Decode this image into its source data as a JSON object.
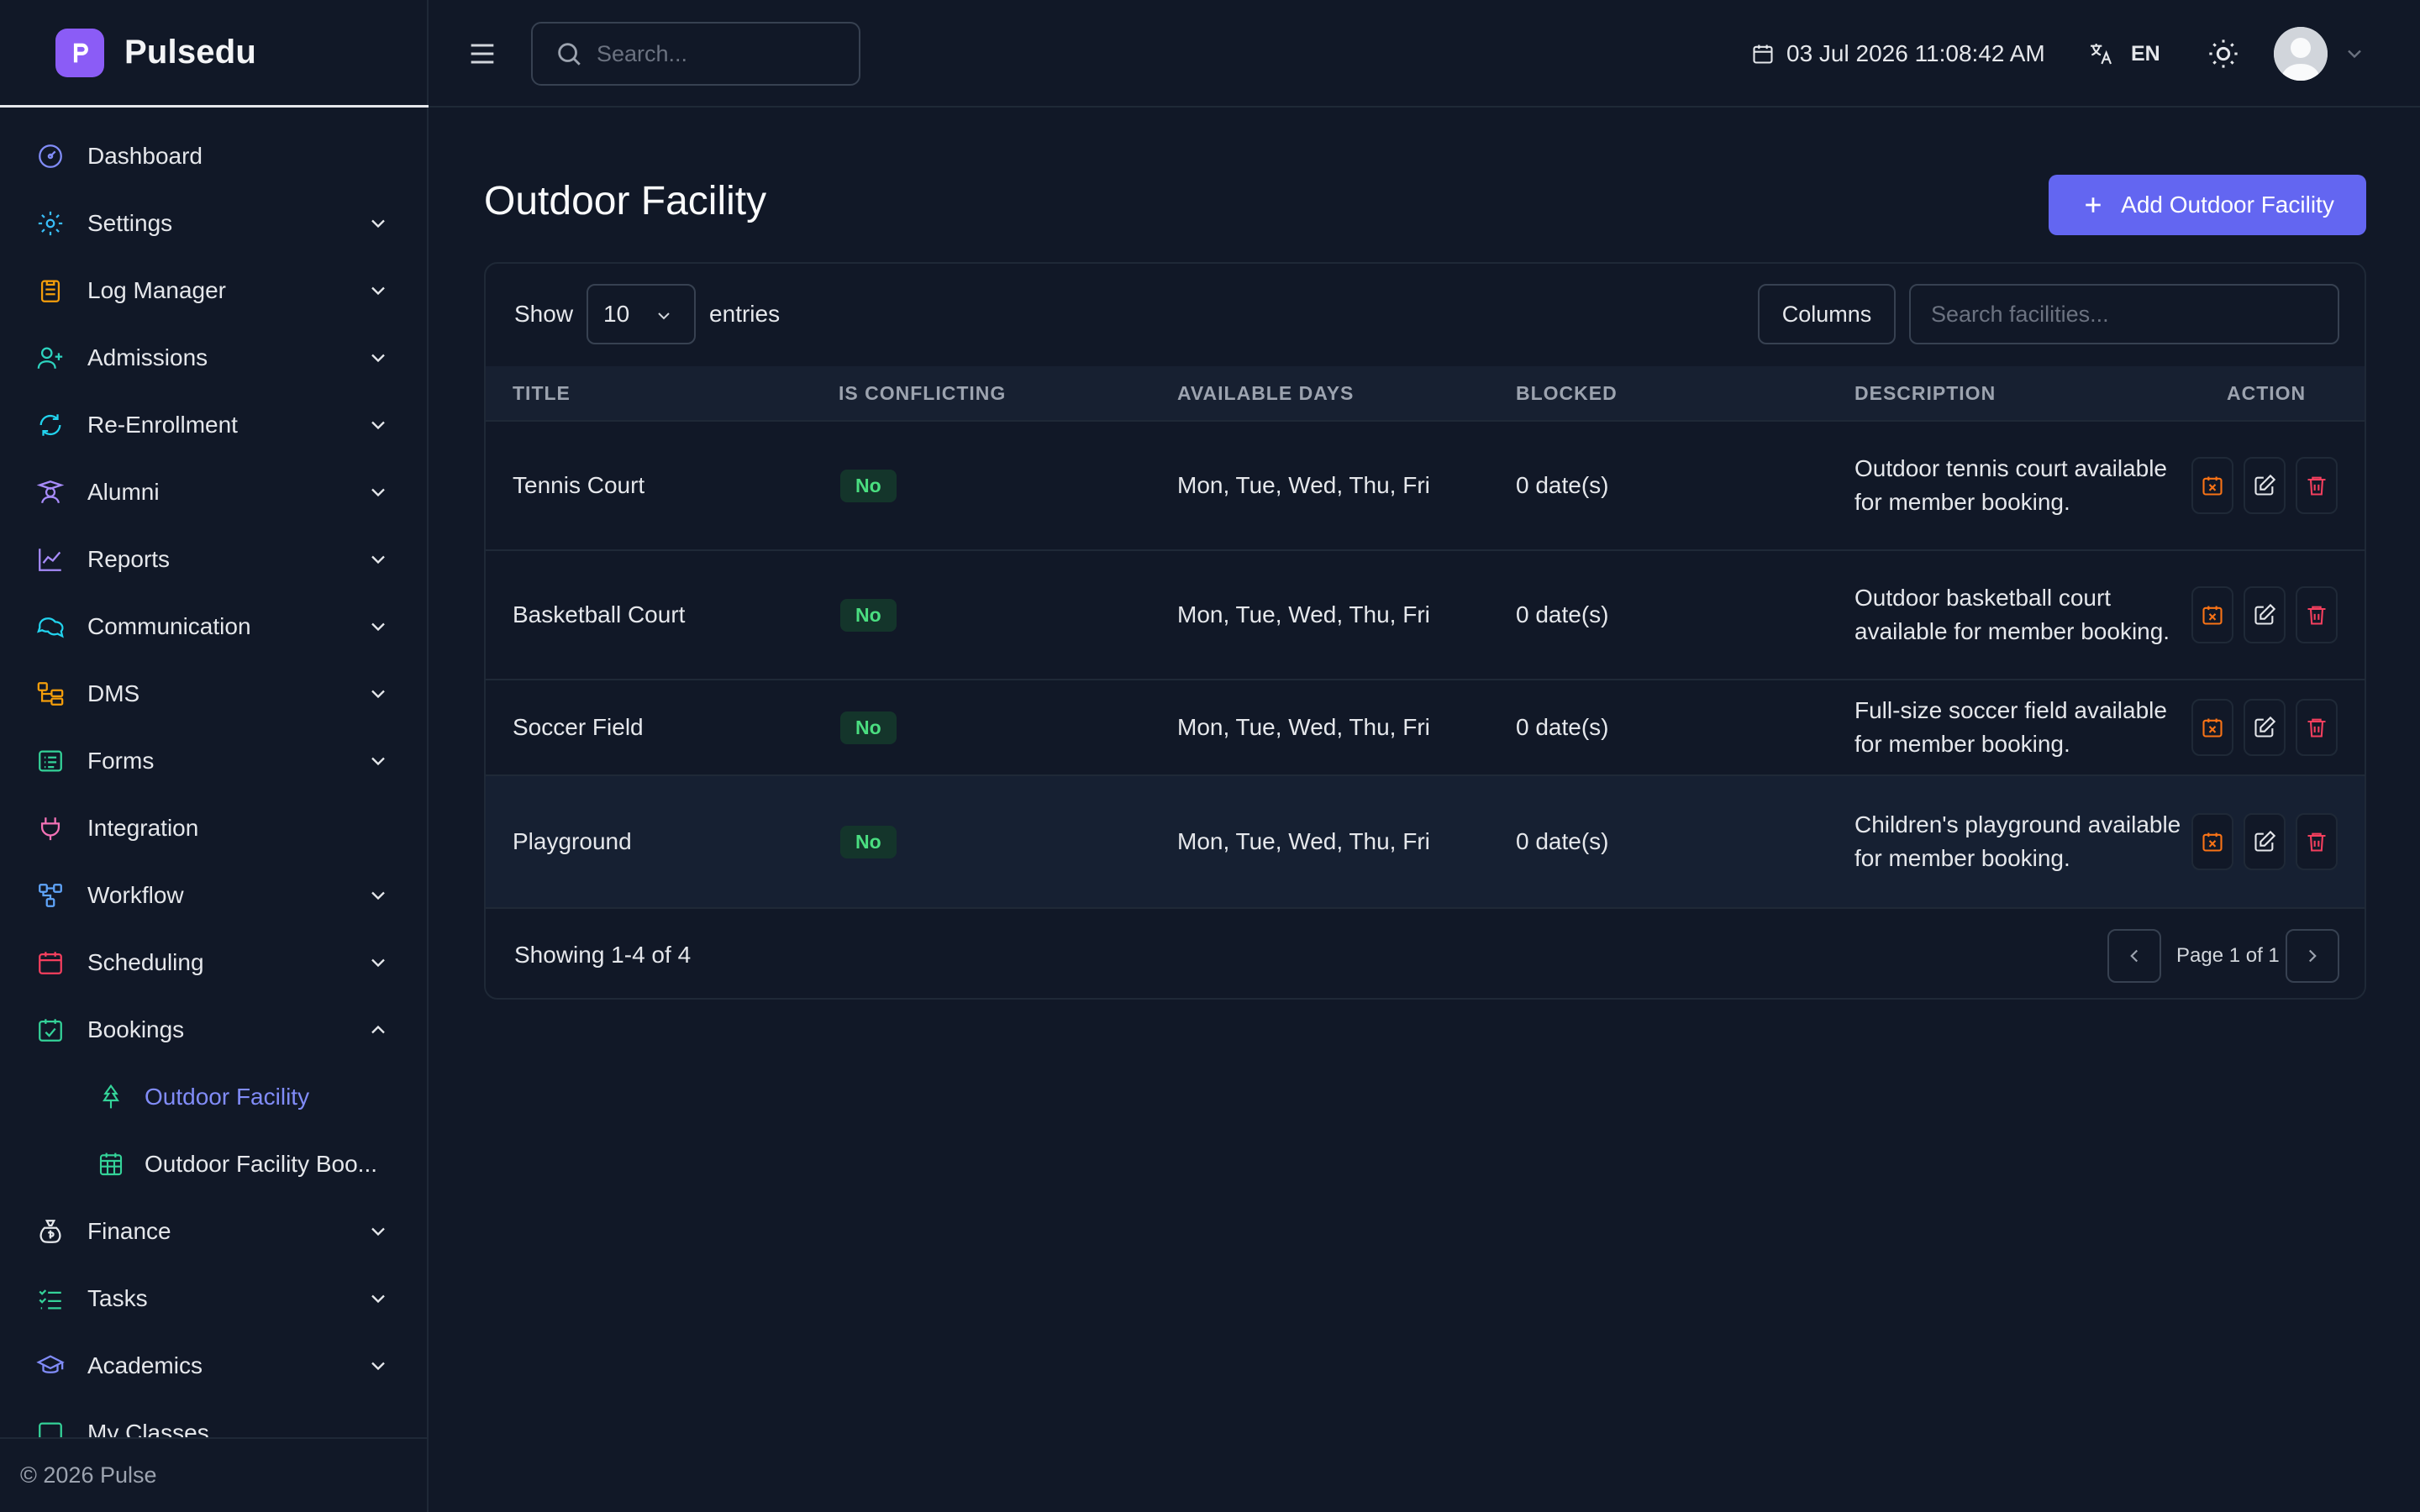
{
  "brand": {
    "name": "Pulsedu"
  },
  "sidebar": {
    "items": [
      {
        "label": "Dashboard",
        "icon": "dashboard-icon",
        "color": "#818cf8"
      },
      {
        "label": "Settings",
        "icon": "gear-icon",
        "color": "#38bdf8"
      },
      {
        "label": "Log Manager",
        "icon": "clipboard-icon",
        "color": "#f59e0b"
      },
      {
        "label": "Admissions",
        "icon": "user-plus-icon",
        "color": "#2dd4bf"
      },
      {
        "label": "Re-Enrollment",
        "icon": "refresh-icon",
        "color": "#22d3ee"
      },
      {
        "label": "Alumni",
        "icon": "graduate-icon",
        "color": "#a78bfa"
      },
      {
        "label": "Reports",
        "icon": "line-chart-icon",
        "color": "#a78bfa"
      },
      {
        "label": "Communication",
        "icon": "chat-icon",
        "color": "#22d3ee"
      },
      {
        "label": "DMS",
        "icon": "folder-tree-icon",
        "color": "#f59e0b"
      },
      {
        "label": "Forms",
        "icon": "form-icon",
        "color": "#34d399"
      },
      {
        "label": "Integration",
        "icon": "plug-icon",
        "color": "#f472b6"
      },
      {
        "label": "Workflow",
        "icon": "workflow-icon",
        "color": "#60a5fa"
      },
      {
        "label": "Scheduling",
        "icon": "calendar-icon",
        "color": "#f43f5e"
      },
      {
        "label": "Bookings",
        "icon": "calendar-check-icon",
        "color": "#34d399"
      },
      {
        "label": "Outdoor Facility",
        "icon": "tree-icon",
        "color": "#34d399"
      },
      {
        "label": "Outdoor Facility Boo...",
        "icon": "grid-calendar-icon",
        "color": "#34d399"
      },
      {
        "label": "Finance",
        "icon": "money-bag-icon",
        "color": "#e5e7eb"
      },
      {
        "label": "Tasks",
        "icon": "list-check-icon",
        "color": "#34d399"
      },
      {
        "label": "Academics",
        "icon": "mortarboard-icon",
        "color": "#818cf8"
      },
      {
        "label": "My Classes",
        "icon": "classes-icon",
        "color": "#34d399"
      }
    ],
    "footer": "© 2026 Pulse"
  },
  "topbar": {
    "search_placeholder": "Search...",
    "datetime": "03 Jul 2026 11:08:42 AM",
    "language": "EN"
  },
  "main": {
    "title": "Outdoor Facility",
    "add_button": "Add Outdoor Facility",
    "show_label": "Show",
    "entries_value": "10",
    "entries_label": "entries",
    "columns_button": "Columns",
    "table_search_placeholder": "Search facilities...",
    "columns": [
      "TITLE",
      "IS CONFLICTING",
      "AVAILABLE DAYS",
      "BLOCKED",
      "DESCRIPTION",
      "ACTION"
    ],
    "rows": [
      {
        "title": "Tennis Court",
        "conflicting": "No",
        "days": "Mon, Tue, Wed, Thu, Fri",
        "blocked": "0 date(s)",
        "description": "Outdoor tennis court available for member booking."
      },
      {
        "title": "Basketball Court",
        "conflicting": "No",
        "days": "Mon, Tue, Wed, Thu, Fri",
        "blocked": "0 date(s)",
        "description": "Outdoor basketball court available for member booking."
      },
      {
        "title": "Soccer Field",
        "conflicting": "No",
        "days": "Mon, Tue, Wed, Thu, Fri",
        "blocked": "0 date(s)",
        "description": "Full-size soccer field available for member booking."
      },
      {
        "title": "Playground",
        "conflicting": "No",
        "days": "Mon, Tue, Wed, Thu, Fri",
        "blocked": "0 date(s)",
        "description": "Children's playground available for member booking."
      }
    ],
    "showing": "Showing 1-4 of 4",
    "page_text": "Page 1 of 1"
  },
  "colors": {
    "accent": "#6366f1",
    "badge_text": "#4ade80",
    "block_icon": "#f97316",
    "delete_icon": "#f43f5e"
  }
}
